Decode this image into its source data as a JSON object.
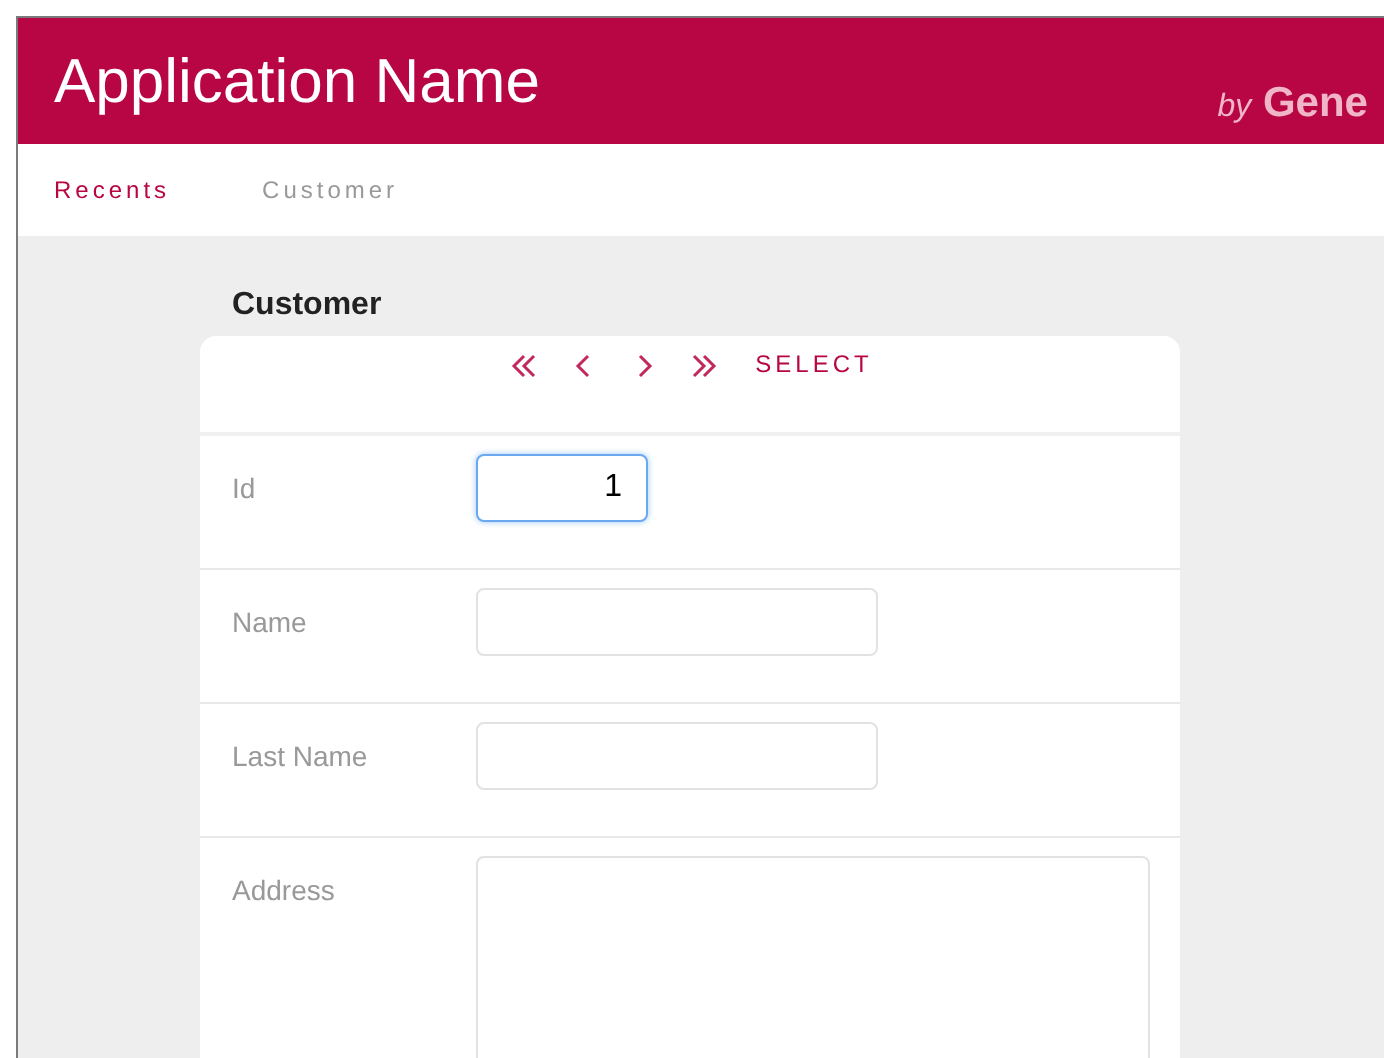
{
  "header": {
    "title": "Application Name",
    "brand_prefix": "by",
    "brand_name": "Gene"
  },
  "breadcrumbs": [
    {
      "label": "Recents",
      "kind": "link"
    },
    {
      "label": "Customer",
      "kind": "current"
    }
  ],
  "form": {
    "title": "Customer",
    "navigation": [
      {
        "kind": "first"
      },
      {
        "kind": "previous"
      },
      {
        "kind": "next"
      },
      {
        "kind": "last"
      }
    ],
    "select_label": "SELECT",
    "fields": [
      {
        "label": "Id",
        "kind": "number",
        "value": "1",
        "focused": true
      },
      {
        "label": "Name",
        "kind": "text",
        "focused": false
      },
      {
        "label": "Last Name",
        "kind": "text",
        "focused": false
      },
      {
        "label": "Address",
        "kind": "textarea",
        "focused": false
      }
    ]
  }
}
